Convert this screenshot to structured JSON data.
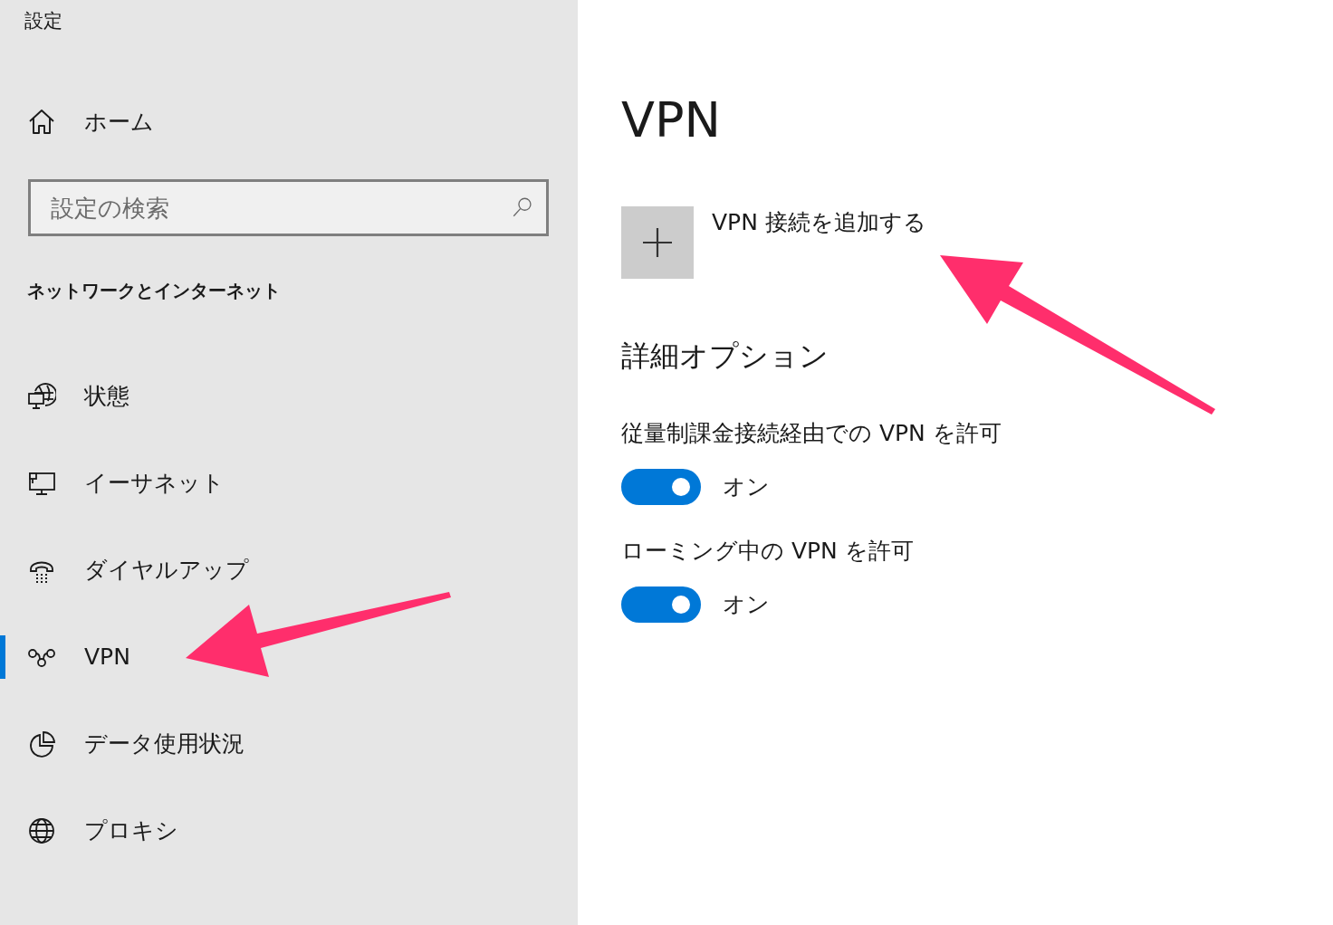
{
  "window": {
    "title": "設定"
  },
  "sidebar": {
    "home": {
      "label": "ホーム"
    },
    "search": {
      "placeholder": "設定の検索"
    },
    "section_title": "ネットワークとインターネット",
    "items": [
      {
        "label": "状態",
        "selected": false
      },
      {
        "label": "イーサネット",
        "selected": false
      },
      {
        "label": "ダイヤルアップ",
        "selected": false
      },
      {
        "label": "VPN",
        "selected": true
      },
      {
        "label": "データ使用状況",
        "selected": false
      },
      {
        "label": "プロキシ",
        "selected": false
      }
    ]
  },
  "content": {
    "title": "VPN",
    "add_connection": {
      "label": "VPN 接続を追加する"
    },
    "advanced_title": "詳細オプション",
    "options": [
      {
        "label": "従量制課金接続経由での VPN を許可",
        "on": true,
        "state_text": "オン"
      },
      {
        "label": "ローミング中の VPN を許可",
        "on": true,
        "state_text": "オン"
      }
    ]
  },
  "annotation_arrows": [
    {
      "kind": "leftward"
    },
    {
      "kind": "upleftward"
    }
  ]
}
